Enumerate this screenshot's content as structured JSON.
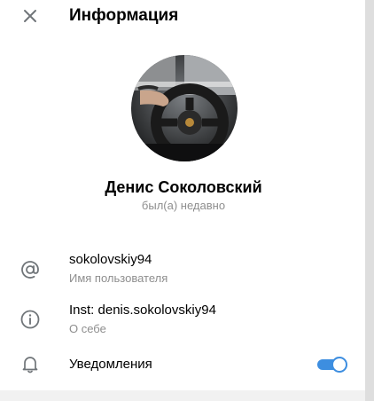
{
  "header": {
    "close_icon": "close-icon",
    "title": "Информация"
  },
  "profile": {
    "name": "Денис Соколовский",
    "status": "был(а) недавно"
  },
  "info": {
    "username": {
      "icon": "at-icon",
      "value": "sokolovskiy94",
      "label": "Имя пользователя"
    },
    "bio": {
      "icon": "info-icon",
      "value": "Inst: denis.sokolovskiy94",
      "label": "О себе"
    },
    "notifications": {
      "icon": "bell-icon",
      "label": "Уведомления",
      "enabled": true
    }
  },
  "colors": {
    "accent": "#3d8ee0",
    "secondary_text": "#8e8e8e",
    "icon": "#707579"
  }
}
